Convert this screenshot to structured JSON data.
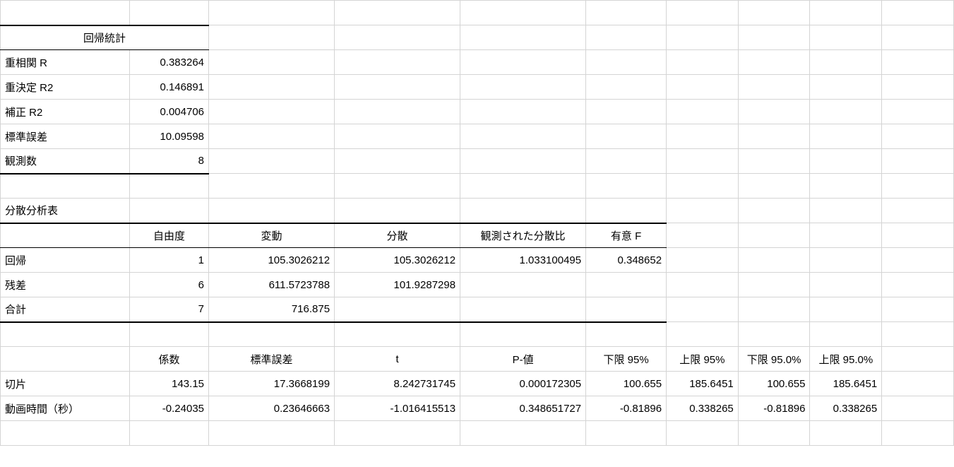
{
  "regression_stats": {
    "title": "回帰統計",
    "rows": [
      {
        "label": "重相関 R",
        "value": "0.383264"
      },
      {
        "label": "重決定 R2",
        "value": "0.146891"
      },
      {
        "label": "補正 R2",
        "value": "0.004706"
      },
      {
        "label": "標準誤差",
        "value": "10.09598"
      },
      {
        "label": "観測数",
        "value": "8"
      }
    ]
  },
  "anova": {
    "title": "分散分析表",
    "headers": {
      "df": "自由度",
      "ss": "変動",
      "ms": "分散",
      "f": "観測された分散比",
      "sigf": "有意 F"
    },
    "rows": [
      {
        "label": "回帰",
        "df": "1",
        "ss": "105.3026212",
        "ms": "105.3026212",
        "f": "1.033100495",
        "sigf": "0.348652"
      },
      {
        "label": "残差",
        "df": "6",
        "ss": "611.5723788",
        "ms": "101.9287298",
        "f": "",
        "sigf": ""
      },
      {
        "label": "合計",
        "df": "7",
        "ss": "716.875",
        "ms": "",
        "f": "",
        "sigf": ""
      }
    ]
  },
  "coefficients": {
    "headers": {
      "coef": "係数",
      "se": "標準誤差",
      "t": "t ",
      "p": "P-値",
      "lo95": "下限 95%",
      "up95": "上限 95%",
      "lo950": "下限 95.0%",
      "up950": "上限 95.0%"
    },
    "rows": [
      {
        "label": "切片",
        "coef": "143.15",
        "se": "17.3668199",
        "t": "8.242731745",
        "p": "0.000172305",
        "lo95": "100.655",
        "up95": "185.6451",
        "lo950": "100.655",
        "up950": "185.6451"
      },
      {
        "label": "動画時間（秒）",
        "coef": "-0.24035",
        "se": "0.23646663",
        "t": "-1.016415513",
        "p": "0.348651727",
        "lo95": "-0.81896",
        "up95": "0.338265",
        "lo950": "-0.81896",
        "up950": "0.338265"
      }
    ]
  }
}
